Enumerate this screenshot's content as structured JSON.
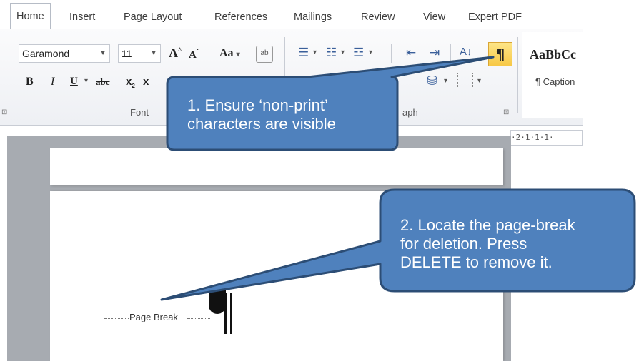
{
  "tabs": [
    "Home",
    "Insert",
    "Page Layout",
    "References",
    "Mailings",
    "Review",
    "View",
    "Expert PDF"
  ],
  "font": {
    "name": "Garamond",
    "size": "11",
    "group_label": "Font",
    "grow_label": "A",
    "shrink_label": "A",
    "case_label": "Aa",
    "bold": "B",
    "italic": "I",
    "underline": "U",
    "strike": "abc",
    "subscript": "x",
    "superscript": "x"
  },
  "paragraph": {
    "group_label": "aph",
    "show_hide": "¶",
    "sort": "A↓"
  },
  "styles": {
    "preview": "AaBbCc",
    "caption": "¶ Caption"
  },
  "ruler": {
    "text": "·2·1·1·1·"
  },
  "document": {
    "page_break_label": "Page Break"
  },
  "callouts": {
    "one": [
      "1. Ensure ‘non-print’",
      "characters are visible"
    ],
    "two": [
      "2. Locate the page-break",
      "for deletion. Press",
      "DELETE to remove it."
    ]
  },
  "colors": {
    "callout_fill": "#4f81bd",
    "callout_stroke": "#2c4d75",
    "highlight": "#f7c846"
  }
}
